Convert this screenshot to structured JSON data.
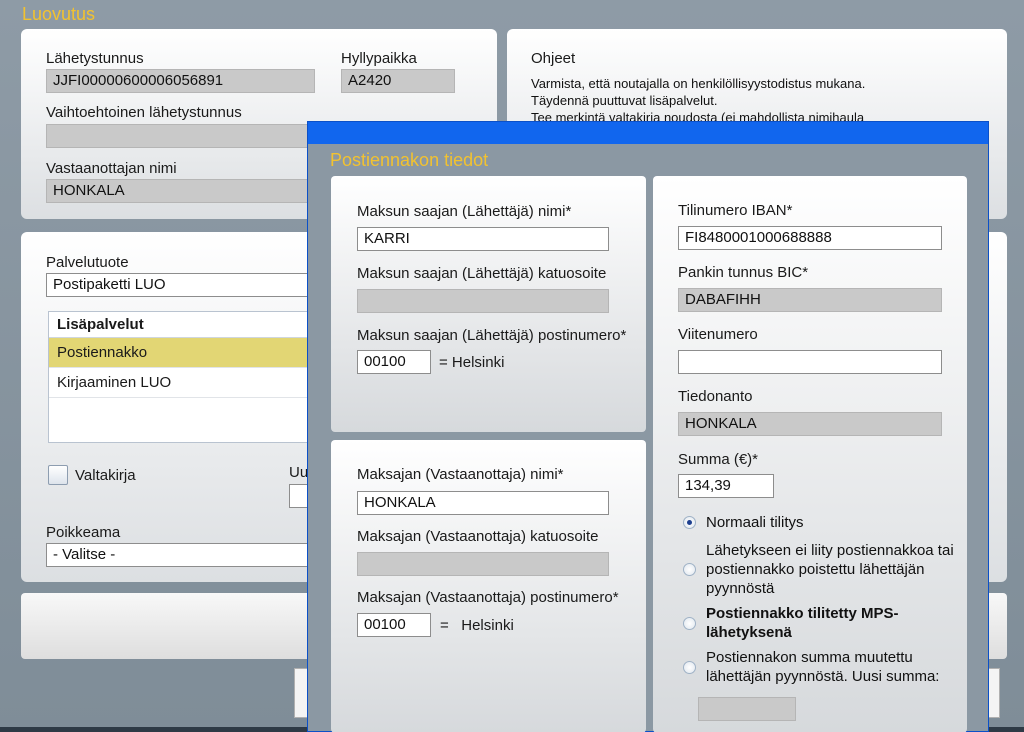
{
  "app": {
    "title": "Luovutus"
  },
  "shipment": {
    "tracking_label": "Lähetystunnus",
    "tracking_value": "JJFI00000600006056891",
    "shelf_label": "Hyllypaikka",
    "shelf_value": "A2420",
    "alt_tracking_label": "Vaihtoehtoinen lähetystunnus",
    "alt_tracking_value": "",
    "recipient_label": "Vastaanottajan nimi",
    "recipient_value": "HONKALA"
  },
  "instructions": {
    "title": "Ohjeet",
    "lines": [
      "Varmista, että noutajalla on henkilöllisyystodistus mukana.",
      "Täydennä puuttuvat lisäpalvelut.",
      "Tee merkintä valtakirja noudosta (ei mahdollista nimihaula"
    ]
  },
  "service": {
    "product_label": "Palvelutuote",
    "product_value": "Postipaketti LUO",
    "addons_header": "Lisäpalvelut",
    "addons": [
      "Postiennakko",
      "Kirjaaminen LUO"
    ],
    "proxy_label": "Valtakirja",
    "partial_label": "Uu",
    "exception_label": "Poikkeama",
    "exception_value": "- Valitse -"
  },
  "modal": {
    "title": "Postiennakon tiedot",
    "payee_name_label": "Maksun saajan (Lähettäjä) nimi*",
    "payee_name_value": "KARRI",
    "payee_street_label": "Maksun saajan (Lähettäjä) katuosoite",
    "payee_street_value": "",
    "payee_zip_label": "Maksun saajan (Lähettäjä) postinumero*",
    "payee_zip_value": "00100",
    "payee_city": "= Helsinki",
    "payer_name_label": "Maksajan (Vastaanottaja) nimi*",
    "payer_name_value": "HONKALA",
    "payer_street_label": "Maksajan (Vastaanottaja) katuosoite",
    "payer_street_value": "",
    "payer_zip_label": "Maksajan (Vastaanottaja) postinumero*",
    "payer_zip_value": "00100",
    "payer_city": "=   Helsinki",
    "iban_label": "Tilinumero IBAN*",
    "iban_value": "FI8480001000688888",
    "bic_label": "Pankin tunnus BIC*",
    "bic_value": "DABAFIHH",
    "reference_label": "Viitenumero",
    "reference_value": "",
    "message_label": "Tiedonanto",
    "message_value": "HONKALA",
    "amount_label": "Summa (€)*",
    "amount_value": "134,39",
    "settlement_options": [
      "Normaali tilitys",
      "Lähetykseen ei liity postiennakkoa tai postiennakko poistettu lähettäjän pyynnöstä",
      "Postiennakko tilitetty MPS-lähetyksenä",
      "Postiennakon summa muutettu lähettäjän pyynnöstä. Uusi summa:"
    ],
    "new_amount_value": ""
  }
}
